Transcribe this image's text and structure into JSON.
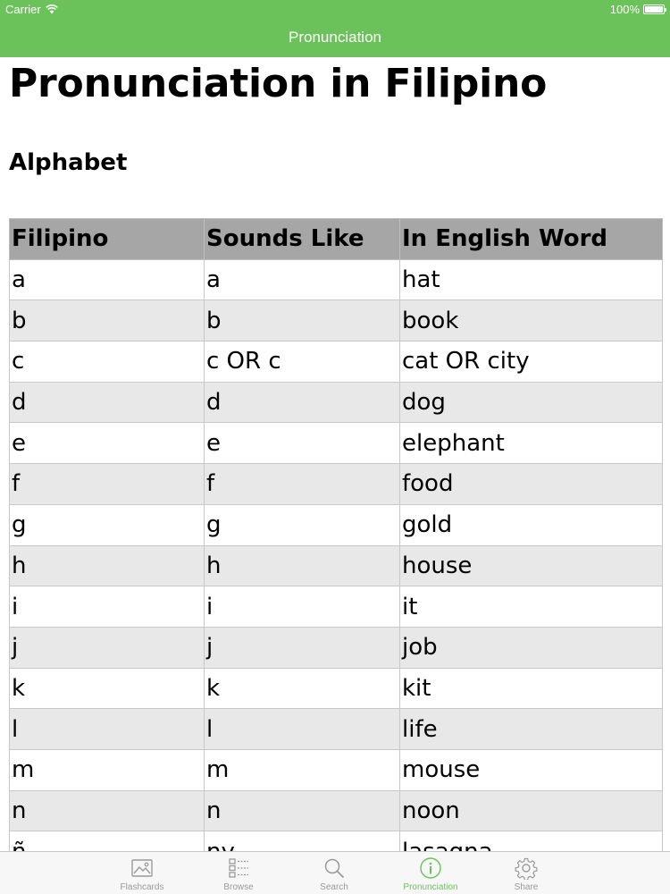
{
  "status_bar": {
    "carrier": "Carrier",
    "battery": "100%"
  },
  "nav": {
    "title": "Pronunciation"
  },
  "page": {
    "title": "Pronunciation in Filipino",
    "section": "Alphabet"
  },
  "table": {
    "headers": [
      "Filipino",
      "Sounds Like",
      "In English Word"
    ],
    "rows": [
      [
        "a",
        "a",
        "hat"
      ],
      [
        "b",
        "b",
        "book"
      ],
      [
        "c",
        "c OR c",
        "cat OR city"
      ],
      [
        "d",
        "d",
        "dog"
      ],
      [
        "e",
        "e",
        "elephant"
      ],
      [
        "f",
        "f",
        "food"
      ],
      [
        "g",
        "g",
        "gold"
      ],
      [
        "h",
        "h",
        "house"
      ],
      [
        "i",
        "i",
        "it"
      ],
      [
        "j",
        "j",
        "job"
      ],
      [
        "k",
        "k",
        "kit"
      ],
      [
        "l",
        "l",
        "life"
      ],
      [
        "m",
        "m",
        "mouse"
      ],
      [
        "n",
        "n",
        "noon"
      ],
      [
        "ñ",
        "ny",
        "lasagna"
      ]
    ]
  },
  "tab_bar": {
    "items": [
      {
        "label": "Flashcards",
        "icon": "image-icon"
      },
      {
        "label": "Browse",
        "icon": "list-icon"
      },
      {
        "label": "Search",
        "icon": "search-icon"
      },
      {
        "label": "Pronunciation",
        "icon": "info-icon"
      },
      {
        "label": "Share",
        "icon": "gear-icon"
      }
    ],
    "active_index": 3
  },
  "colors": {
    "accent": "#6cc25a",
    "header_cell": "#a6a6a6",
    "alt_row": "#e8e8e8",
    "tab_inactive": "#9a9a9a"
  }
}
